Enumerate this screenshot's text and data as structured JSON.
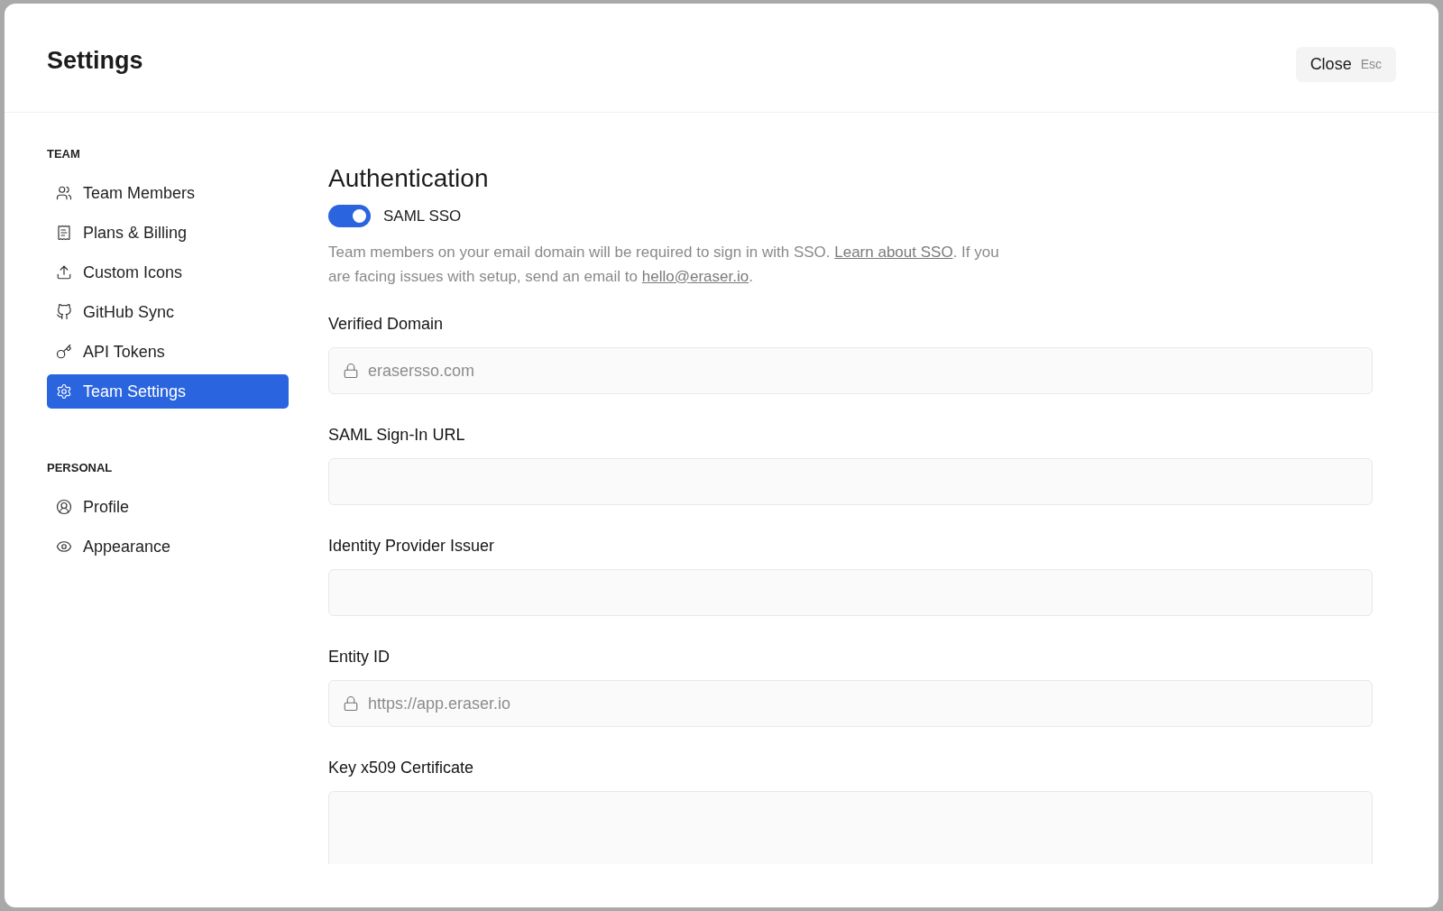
{
  "window": {
    "title": "Settings"
  },
  "close_button": {
    "label": "Close",
    "shortcut": "Esc"
  },
  "sidebar": {
    "sections": [
      {
        "heading": "TEAM",
        "items": [
          {
            "kind": "members",
            "label": "Team Members",
            "selected": false
          },
          {
            "kind": "billing",
            "label": "Plans & Billing",
            "selected": false
          },
          {
            "kind": "upload",
            "label": "Custom Icons",
            "selected": false
          },
          {
            "kind": "github",
            "label": "GitHub Sync",
            "selected": false
          },
          {
            "kind": "key",
            "label": "API Tokens",
            "selected": false
          },
          {
            "kind": "gear",
            "label": "Team Settings",
            "selected": true
          }
        ]
      },
      {
        "heading": "PERSONAL",
        "items": [
          {
            "kind": "profile",
            "label": "Profile",
            "selected": false
          },
          {
            "kind": "eye",
            "label": "Appearance",
            "selected": false
          }
        ]
      }
    ]
  },
  "content": {
    "heading": "Authentication",
    "toggle": {
      "label": "SAML SSO",
      "on": true
    },
    "description": [
      {
        "kind": "text",
        "text": "Team members on your email domain will be required to sign in with SSO. "
      },
      {
        "kind": "link",
        "text": "Learn about SSO"
      },
      {
        "kind": "text",
        "text": ". If you are facing issues with setup, send an email to "
      },
      {
        "kind": "link",
        "text": "hello@eraser.io"
      },
      {
        "kind": "text",
        "text": "."
      }
    ],
    "fields": [
      {
        "kind": "input",
        "label": "Verified Domain",
        "value": "erasersso.com",
        "locked": true
      },
      {
        "kind": "input",
        "label": "SAML Sign-In URL",
        "locked": false
      },
      {
        "kind": "input",
        "label": "Identity Provider Issuer",
        "locked": false
      },
      {
        "kind": "input",
        "label": "Entity ID",
        "value": "https://app.eraser.io",
        "locked": true
      },
      {
        "kind": "textarea",
        "label": "Key x509 Certificate"
      }
    ]
  }
}
